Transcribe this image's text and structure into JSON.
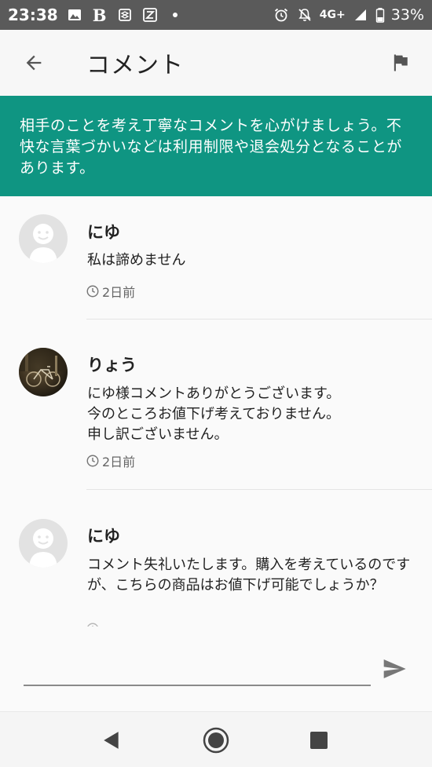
{
  "status_bar": {
    "time": "23:38",
    "network": "4G+",
    "battery": "33%",
    "icons": [
      "image-icon",
      "b-icon",
      "app-icon",
      "z-icon",
      "dot-icon",
      "alarm-icon",
      "mute-icon",
      "signal-icon",
      "battery-icon"
    ]
  },
  "header": {
    "title": "コメント",
    "back_icon": "arrow-left-icon",
    "report_icon": "flag-icon"
  },
  "notice": {
    "text": "相手のことを考え丁寧なコメントを心がけましょう。不快な言葉づかいなどは利用制限や退会処分となることがあります。"
  },
  "comments": [
    {
      "name": "にゆ",
      "text": "私は諦めません",
      "time": "2日前",
      "avatar": "default-avatar"
    },
    {
      "name": "りょう",
      "text": "にゆ様コメントありがとうございます。\n今のところお値下げ考えておりません。\n申し訳ございません。",
      "time": "2日前",
      "avatar": "photo-avatar"
    },
    {
      "name": "にゆ",
      "text": "コメント失礼いたします。購入を考えているのですが、こちらの商品はお値下げ可能でしょうか？",
      "time": "",
      "avatar": "default-avatar"
    }
  ],
  "input": {
    "placeholder": "",
    "send_icon": "send-icon"
  },
  "nav": {
    "back_icon": "nav-back-icon",
    "home_icon": "nav-home-icon",
    "recents_icon": "nav-recents-icon"
  }
}
